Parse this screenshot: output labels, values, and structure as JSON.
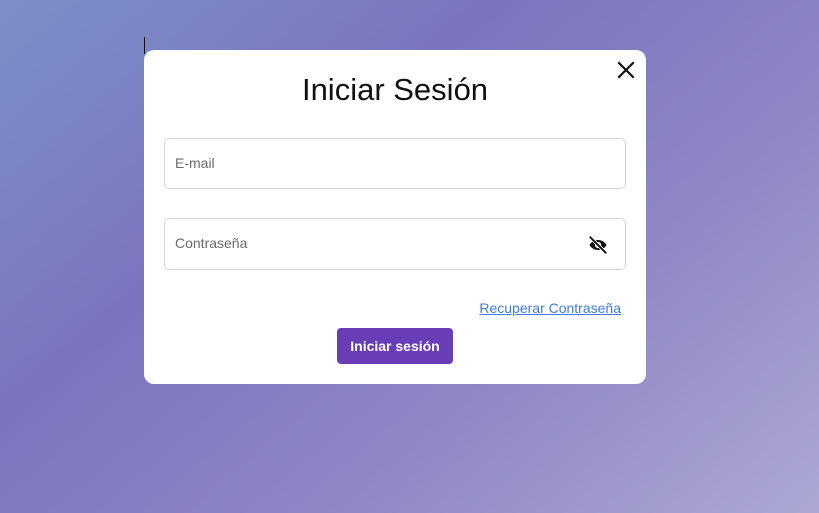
{
  "login_modal": {
    "title": "Iniciar Sesión",
    "close_icon": "close-icon",
    "email_field": {
      "label": "E-mail",
      "value": ""
    },
    "password_field": {
      "label": "Contraseña",
      "value": "",
      "visibility_icon": "eye-off-icon"
    },
    "recover_link_label": "Recuperar Contraseña",
    "submit_label": "Iniciar sesión"
  },
  "colors": {
    "primary_button": "#6a3db8",
    "link": "#3d7be0",
    "background_gradient_start": "#7b8fc8",
    "background_gradient_end": "#aca8d3"
  }
}
